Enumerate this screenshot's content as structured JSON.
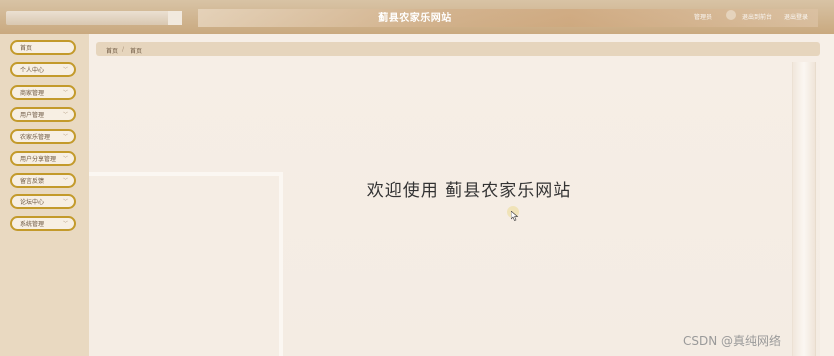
{
  "header": {
    "title": "蓟县农家乐网站",
    "user_label": "管理员",
    "link_front": "退出到前台",
    "link_logout": "退出登录"
  },
  "sidebar": {
    "items": [
      {
        "label": "首页",
        "has_chevron": false
      },
      {
        "label": "个人中心",
        "has_chevron": true
      },
      {
        "label": "商家管理",
        "has_chevron": true
      },
      {
        "label": "用户管理",
        "has_chevron": true
      },
      {
        "label": "农家乐管理",
        "has_chevron": true
      },
      {
        "label": "用户分享管理",
        "has_chevron": true
      },
      {
        "label": "留言反馈",
        "has_chevron": true
      },
      {
        "label": "论坛中心",
        "has_chevron": true
      },
      {
        "label": "系统管理",
        "has_chevron": true
      }
    ],
    "chevron_icon": "chevron-down-icon"
  },
  "breadcrumb": {
    "home": "首页",
    "separator": "/",
    "current": "首页"
  },
  "main": {
    "welcome_text": "欢迎使用  蓟县农家乐网站"
  },
  "watermark": "CSDN @真纯网络",
  "colors": {
    "accent": "#c39a2b",
    "header": "#c9a97f",
    "sidebar": "#e9d9c1"
  }
}
